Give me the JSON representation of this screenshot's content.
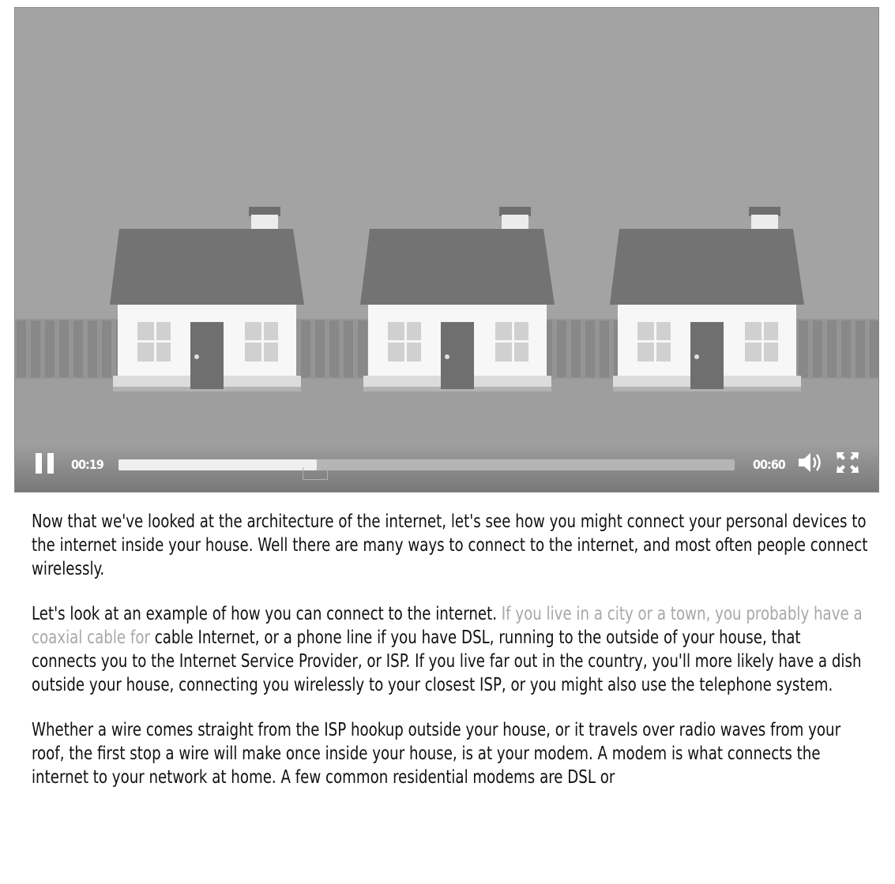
{
  "player": {
    "current_time": "00:19",
    "total_time": "00:60",
    "progress_fraction": 0.322,
    "icons": [
      "pause-icon",
      "volume-icon",
      "fullscreen-icon"
    ],
    "colors": {
      "background": "#a3a3a3",
      "progress_fill": "#efefef",
      "progress_track": "#b5b5b5"
    }
  },
  "transcript": {
    "p1": "Now that we've looked at the architecture of the internet, let's see how you might connect your personal devices to the internet inside your house. Well there are many ways to connect to the internet, and most often people connect wirelessly.",
    "p2_before": "Let's look at an example of how you can connect to the internet. ",
    "p2_highlight": "If you live in a city or a town, you probably have a coaxial cable for",
    "p2_after": " cable Internet, or a phone line if you have DSL, running to the outside of your house, that connects you to the Internet Service Provider, or ISP. If you live far out in the country, you'll more likely have a dish outside your house, connecting you wirelessly to your closest ISP, or you might also use the telephone system.",
    "p3": "Whether a wire comes straight from the ISP hookup outside your house, or it travels over radio waves from your roof, the first stop a wire will make once inside your house, is at your modem. A modem is what connects the internet to your network at home. A few common residential modems are DSL or"
  }
}
